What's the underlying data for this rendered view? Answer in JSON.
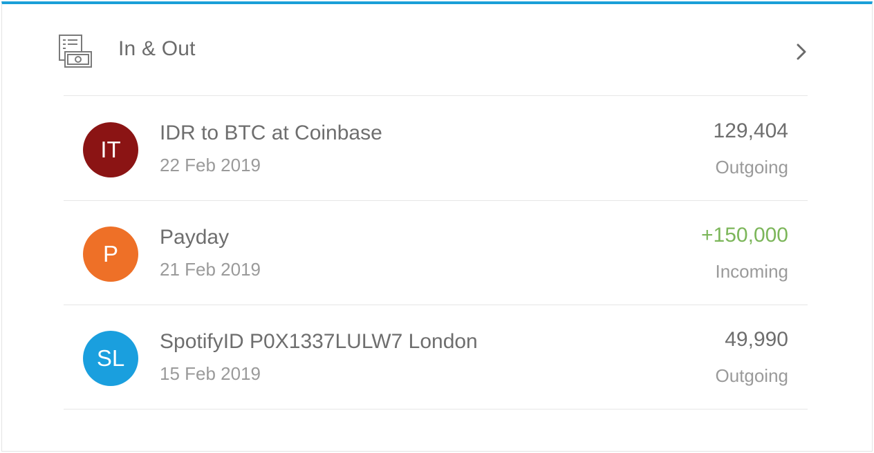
{
  "colors": {
    "accent": "#1a9fd8",
    "incoming": "#7cb65a",
    "text": "#6e6e6e",
    "muted": "#9a9a9a"
  },
  "header": {
    "icon": "bills-money-icon",
    "title": "In & Out",
    "chevron_icon": "chevron-right-icon"
  },
  "transactions": [
    {
      "initials": "IT",
      "avatar_color": "#8b1414",
      "title": "IDR to BTC at Coinbase",
      "date": "22 Feb 2019",
      "amount": "129,404",
      "type": "Outgoing"
    },
    {
      "initials": "P",
      "avatar_color": "#ee7027",
      "title": "Payday",
      "date": "21 Feb 2019",
      "amount": "+150,000",
      "type": "Incoming"
    },
    {
      "initials": "SL",
      "avatar_color": "#1a9fde",
      "title": "SpotifyID P0X1337LULW7 London",
      "date": "15 Feb 2019",
      "amount": "49,990",
      "type": "Outgoing"
    }
  ]
}
